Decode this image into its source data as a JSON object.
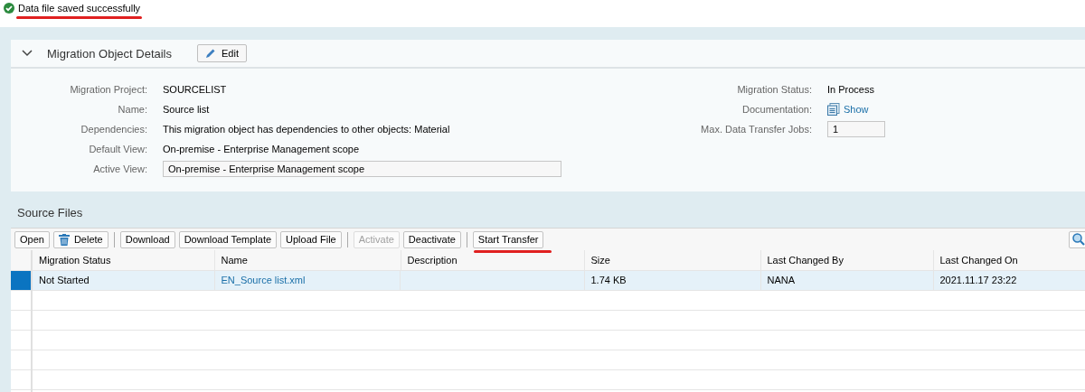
{
  "message": {
    "kind": "success",
    "text": "Data file saved successfully",
    "underlined": true
  },
  "details": {
    "title": "Migration Object Details",
    "expanded": true,
    "edit_button": "Edit",
    "left_fields": [
      {
        "label": "Migration Project:",
        "value": "SOURCELIST",
        "kind": "text"
      },
      {
        "label": "Name:",
        "value": "Source list",
        "kind": "text"
      },
      {
        "label": "Dependencies:",
        "value": "This migration object has dependencies to other objects: Material",
        "kind": "text"
      },
      {
        "label": "Default View:",
        "value": "On-premise - Enterprise Management scope",
        "kind": "text"
      },
      {
        "label": "Active View:",
        "value": "On-premise - Enterprise Management scope",
        "kind": "input"
      }
    ],
    "right_fields": [
      {
        "label": "Migration Status:",
        "value": "In Process",
        "kind": "text"
      },
      {
        "label": "Documentation:",
        "value": "Show",
        "kind": "link"
      },
      {
        "label": "Max. Data Transfer Jobs:",
        "value": "1",
        "kind": "input"
      }
    ]
  },
  "source_files": {
    "title": "Source Files",
    "toolbar": [
      {
        "kind": "button",
        "label": "Open",
        "disabled": false,
        "underlined": false
      },
      {
        "kind": "delete",
        "label": "Delete",
        "disabled": false,
        "underlined": false
      },
      {
        "kind": "separator"
      },
      {
        "kind": "button",
        "label": "Download",
        "disabled": false,
        "underlined": false
      },
      {
        "kind": "button",
        "label": "Download Template",
        "disabled": false,
        "underlined": false
      },
      {
        "kind": "button",
        "label": "Upload File",
        "disabled": false,
        "underlined": false
      },
      {
        "kind": "separator"
      },
      {
        "kind": "button",
        "label": "Activate",
        "disabled": true,
        "underlined": false
      },
      {
        "kind": "button",
        "label": "Deactivate",
        "disabled": false,
        "underlined": false
      },
      {
        "kind": "separator"
      },
      {
        "kind": "button",
        "label": "Start Transfer",
        "disabled": false,
        "underlined": true
      }
    ],
    "columns": [
      {
        "label": "Migration Status",
        "kind": "text"
      },
      {
        "label": "Name",
        "kind": "link"
      },
      {
        "label": "Description",
        "kind": "text"
      },
      {
        "label": "Size",
        "kind": "text"
      },
      {
        "label": "Last Changed By",
        "kind": "text"
      },
      {
        "label": "Last Changed On",
        "kind": "text"
      }
    ],
    "rows": [
      {
        "selected": true,
        "cells": [
          "Not Started",
          "EN_Source list.xml",
          "",
          "1.74 KB",
          "NANA",
          "2021.11.17 23:22"
        ]
      }
    ]
  }
}
